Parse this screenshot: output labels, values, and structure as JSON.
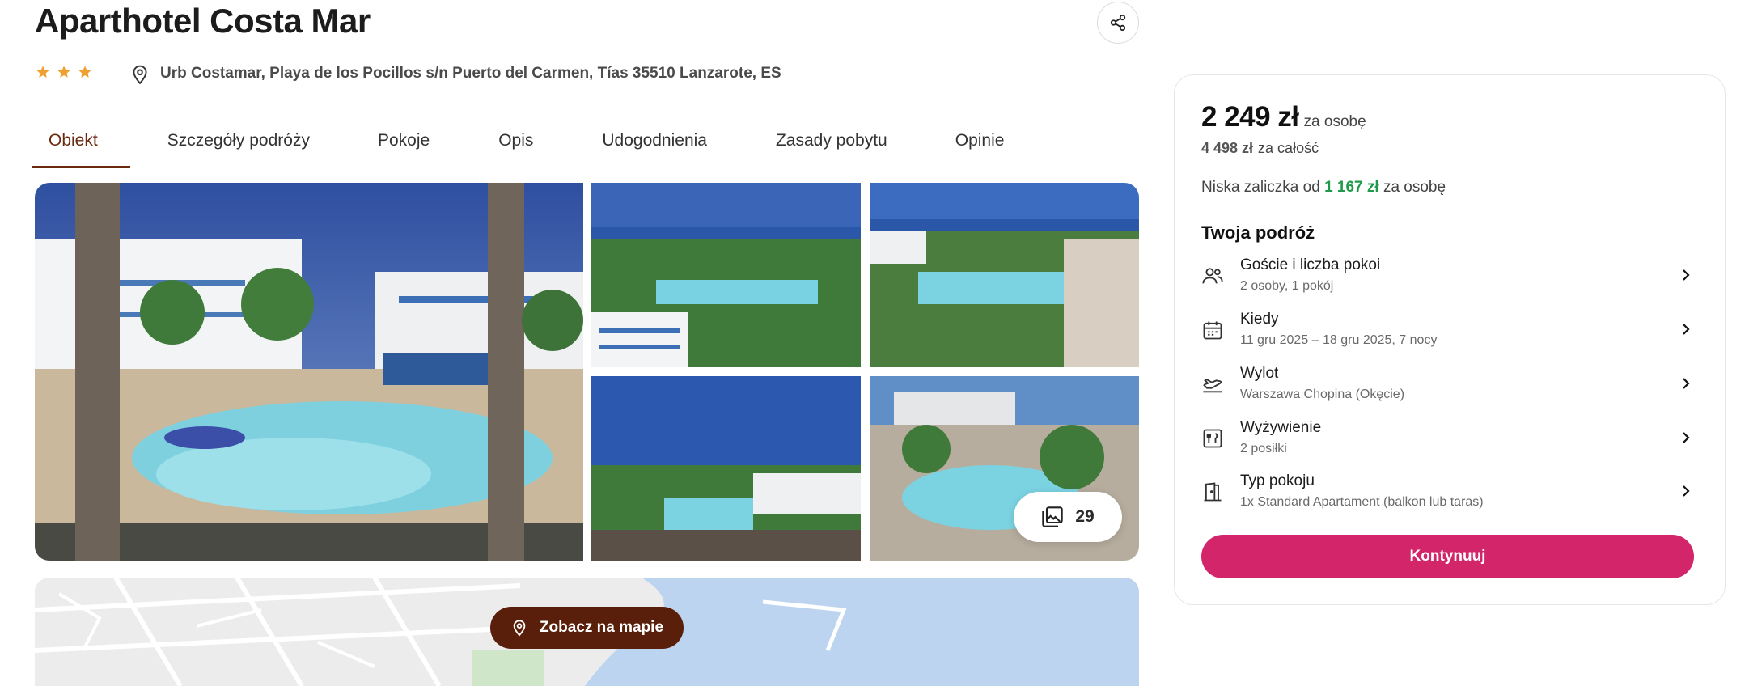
{
  "hotel": {
    "name": "Aparthotel Costa Mar",
    "stars": 3,
    "address": "Urb Costamar, Playa de los Pocillos s/n Puerto del Carmen, Tías 35510 Lanzarote, ES"
  },
  "tabs": [
    {
      "label": "Obiekt",
      "active": true
    },
    {
      "label": "Szczegóły podróży",
      "active": false
    },
    {
      "label": "Pokoje",
      "active": false
    },
    {
      "label": "Opis",
      "active": false
    },
    {
      "label": "Udogodnienia",
      "active": false
    },
    {
      "label": "Zasady pobytu",
      "active": false
    },
    {
      "label": "Opinie",
      "active": false
    }
  ],
  "gallery": {
    "photo_count": "29",
    "icons": {
      "count": "photo-stack-icon",
      "share": "share-icon"
    }
  },
  "map": {
    "button_label": "Zobacz na mapie",
    "icon": "location-pin-icon"
  },
  "booking": {
    "price_per_person": "2 249 zł",
    "per_person_label": "za osobę",
    "price_total": "4 498 zł",
    "total_label": "za całość",
    "deposit_prefix": "Niska zaliczka od",
    "deposit_amount": "1 167 zł",
    "deposit_suffix": "za osobę",
    "trip_title": "Twoja podróż",
    "rows": [
      {
        "label": "Goście i liczba pokoi",
        "value": "2 osoby, 1 pokój",
        "icon": "guests-icon"
      },
      {
        "label": "Kiedy",
        "value": "11 gru 2025 – 18 gru 2025, 7 nocy",
        "icon": "calendar-icon"
      },
      {
        "label": "Wylot",
        "value": "Warszawa Chopina (Okęcie)",
        "icon": "plane-departure-icon"
      },
      {
        "label": "Wyżywienie",
        "value": "2 posiłki",
        "icon": "meal-icon"
      },
      {
        "label": "Typ pokoju",
        "value": "1x Standard Apartament (balkon lub taras)",
        "icon": "door-icon"
      }
    ],
    "continue_label": "Kontynuuj"
  },
  "colors": {
    "brand_brown": "#6b2a10",
    "map_button": "#5a1f0a",
    "cta_pink": "#d2256a",
    "deposit_green": "#1e9a4a",
    "star_gold": "#f0a030"
  }
}
